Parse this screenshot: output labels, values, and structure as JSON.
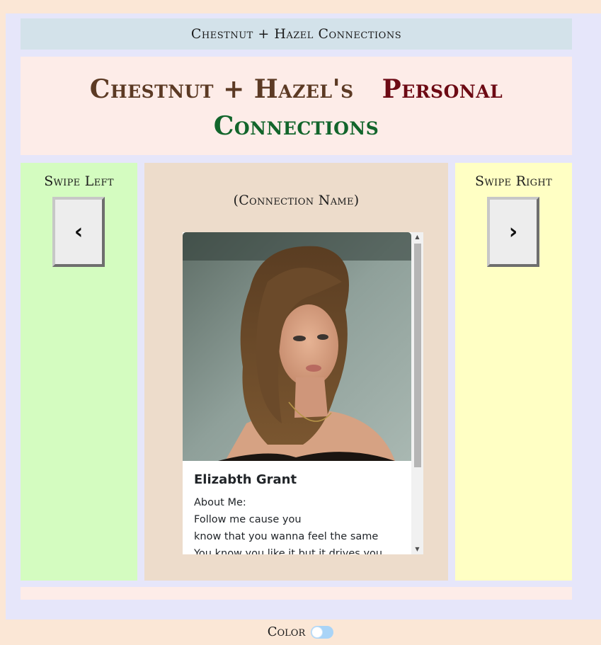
{
  "header": {
    "site_title": "Chestnut + Hazel Connections"
  },
  "hero": {
    "part1": "Chestnut + Hazel's",
    "part2": "Personal",
    "part3": "Connections"
  },
  "left": {
    "label": "Swipe Left",
    "button": "‹"
  },
  "right": {
    "label": "Swipe Right",
    "button": "›"
  },
  "middle": {
    "connection_name": "(Connection Name)",
    "card": {
      "title": "Elizabth Grant",
      "lines": [
        "About Me:",
        "Follow me cause you",
        "know that you wanna feel the same",
        "You know you like it but it drives you"
      ]
    }
  },
  "footer": {
    "color_label": "Color",
    "color_toggle_on": false
  },
  "colors": {
    "page_bg": "#fbe7d6",
    "frame_bg": "#e6e6fa",
    "topbar_bg": "#d3e2ea",
    "hero_bg": "#fdece8",
    "left_bg": "#d4fcc0",
    "middle_bg": "#eddccb",
    "right_bg": "#ffffc4",
    "brown": "#5c3a24",
    "maroon": "#6d0a14",
    "green": "#12652b"
  }
}
